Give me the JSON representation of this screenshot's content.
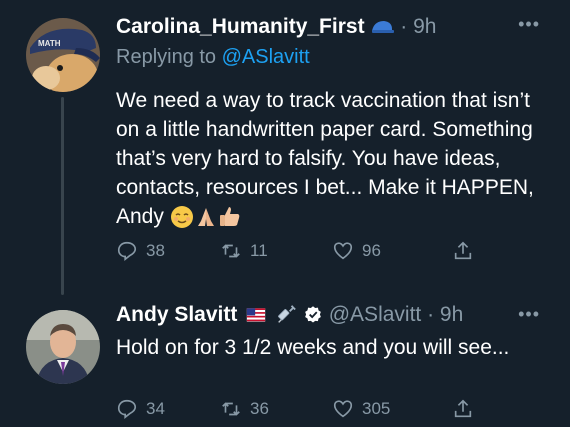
{
  "tweets": [
    {
      "name": "Carolina_Humanity_First",
      "handle": "",
      "time": "· 9h",
      "replying_prefix": "Replying to ",
      "replying_mention": "@ASlavitt",
      "text": "We need a way to track vaccination that isn’t on a little handwritten paper card. Something that’s very hard to falsify. You have ideas, contacts, resources I bet... Make it HAPPEN, Andy",
      "avatar_cap_text": "MATH",
      "counts": {
        "replies": "38",
        "retweets": "11",
        "likes": "96"
      }
    },
    {
      "name": "Andy Slavitt",
      "handle": "@ASlavitt",
      "time": "· 9h",
      "text": "Hold on for 3 1/2 weeks and you will see...",
      "counts": {
        "replies": "34",
        "retweets": "36",
        "likes": "305"
      }
    }
  ],
  "more_label": "•••",
  "colors": {
    "background": "#15202b",
    "secondary_text": "#8899a6",
    "link": "#1da1f2",
    "verified": "#ffffff"
  },
  "icons": [
    "reply-icon",
    "retweet-icon",
    "like-icon",
    "share-icon",
    "verified-icon",
    "blue-cap-emoji",
    "us-flag-emoji",
    "syringe-emoji"
  ]
}
